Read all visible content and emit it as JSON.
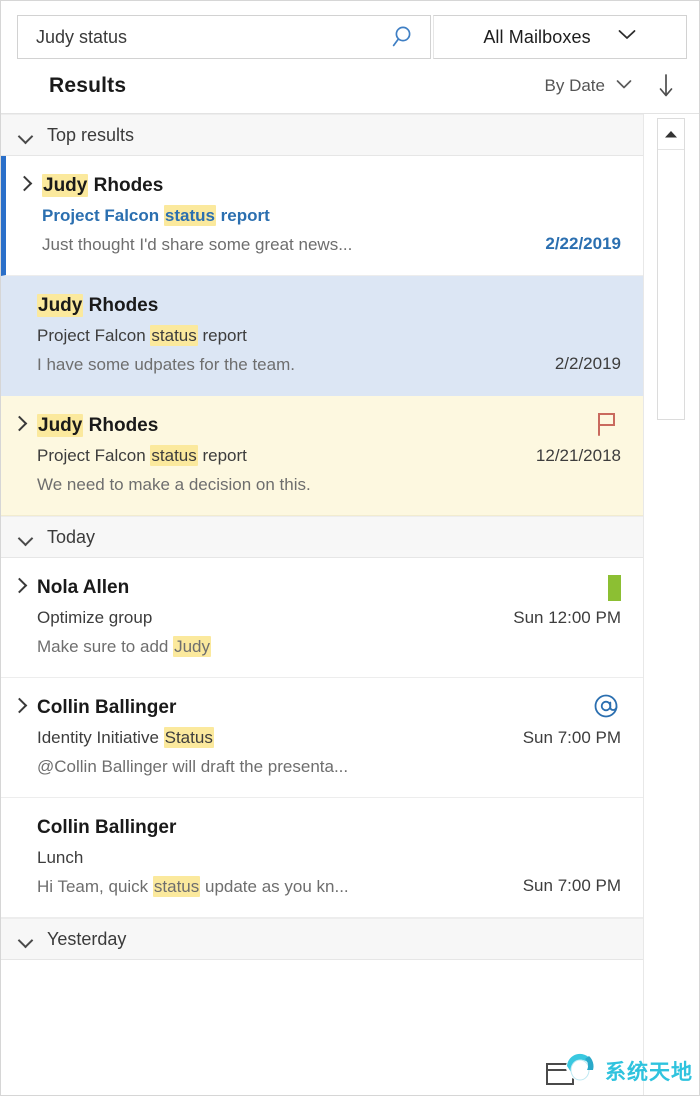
{
  "search": {
    "value": "Judy status",
    "placeholder": "Search",
    "icon": "search-icon",
    "mailbox_scope": "All Mailboxes",
    "mailbox_chevron": "chevron-down-icon"
  },
  "results_header": {
    "title": "Results",
    "sort_label": "By Date",
    "sort_chevron": "chevron-down-icon",
    "sort_direction_icon": "arrow-down-icon"
  },
  "colors": {
    "accent_blue": "#2b6fb0",
    "unread_bar": "#2a6fc9",
    "selected_row": "#dce6f4",
    "flagged_row": "#fdf8e0",
    "highlight": "#fbe99d",
    "category_green": "#8cbf33",
    "flag_red": "#c96a5e",
    "section_bg": "#f7f7f7"
  },
  "scrollbar": {
    "up_arrow_icon": "scroll-up-arrow-icon",
    "thumb": "scroll-thumb"
  },
  "sections": [
    {
      "label": "Top results",
      "chevron": "chevron-down-icon",
      "rows": [
        {
          "sender_parts": [
            {
              "t": "Judy",
              "hl": true
            },
            {
              "t": " Rhodes",
              "hl": false
            }
          ],
          "subject_parts": [
            {
              "t": "Project Falcon ",
              "hl": false
            },
            {
              "t": "status",
              "hl": true
            },
            {
              "t": " report",
              "hl": false
            }
          ],
          "preview_parts": [
            {
              "t": "Just thought I'd share some great news...",
              "hl": false
            }
          ],
          "date": "2/22/2019",
          "unread": true,
          "selected": false,
          "flagged": false,
          "expandable": true,
          "icon": "none"
        },
        {
          "sender_parts": [
            {
              "t": "Judy",
              "hl": true
            },
            {
              "t": " Rhodes",
              "hl": false
            }
          ],
          "subject_parts": [
            {
              "t": "Project Falcon ",
              "hl": false
            },
            {
              "t": "status",
              "hl": true
            },
            {
              "t": " report",
              "hl": false
            }
          ],
          "preview_parts": [
            {
              "t": "I have some udpates for the team.",
              "hl": false
            }
          ],
          "date": "2/2/2019",
          "unread": false,
          "selected": true,
          "flagged": false,
          "expandable": false,
          "icon": "none"
        },
        {
          "sender_parts": [
            {
              "t": "Judy",
              "hl": true
            },
            {
              "t": " Rhodes",
              "hl": false
            }
          ],
          "subject_parts": [
            {
              "t": "Project Falcon ",
              "hl": false
            },
            {
              "t": "status",
              "hl": true
            },
            {
              "t": " report",
              "hl": false
            }
          ],
          "preview_parts": [
            {
              "t": "We need to make a decision on this.",
              "hl": false
            }
          ],
          "date": "12/21/2018",
          "unread": false,
          "selected": false,
          "flagged": true,
          "expandable": true,
          "icon": "flag-icon"
        }
      ]
    },
    {
      "label": "Today",
      "chevron": "chevron-down-icon",
      "rows": [
        {
          "sender_parts": [
            {
              "t": "Nola Allen",
              "hl": false
            }
          ],
          "subject_parts": [
            {
              "t": "Optimize group",
              "hl": false
            }
          ],
          "preview_parts": [
            {
              "t": "Make sure to add ",
              "hl": false
            },
            {
              "t": "Judy",
              "hl": true
            }
          ],
          "date": "Sun 12:00 PM",
          "unread": false,
          "selected": false,
          "flagged": false,
          "expandable": true,
          "icon": "category-color-bar-icon"
        },
        {
          "sender_parts": [
            {
              "t": "Collin Ballinger",
              "hl": false
            }
          ],
          "subject_parts": [
            {
              "t": "Identity Initiative ",
              "hl": false
            },
            {
              "t": "Status",
              "hl": true
            }
          ],
          "preview_parts": [
            {
              "t": "@Collin Ballinger will draft the presenta...",
              "hl": false
            }
          ],
          "date": "Sun 7:00 PM",
          "unread": false,
          "selected": false,
          "flagged": false,
          "expandable": true,
          "icon": "at-mention-icon"
        },
        {
          "sender_parts": [
            {
              "t": "Collin Ballinger",
              "hl": false
            }
          ],
          "subject_parts": [
            {
              "t": "Lunch",
              "hl": false
            }
          ],
          "preview_parts": [
            {
              "t": "Hi Team, quick ",
              "hl": false
            },
            {
              "t": "status",
              "hl": true
            },
            {
              "t": " update as you kn...",
              "hl": false
            }
          ],
          "date": "Sun 7:00 PM",
          "unread": false,
          "selected": false,
          "flagged": false,
          "expandable": false,
          "icon": "none"
        }
      ]
    },
    {
      "label": "Yesterday",
      "chevron": "chevron-down-icon",
      "rows": []
    }
  ],
  "watermark": {
    "text": "系统天地",
    "logo": "watermark-logo-icon"
  }
}
